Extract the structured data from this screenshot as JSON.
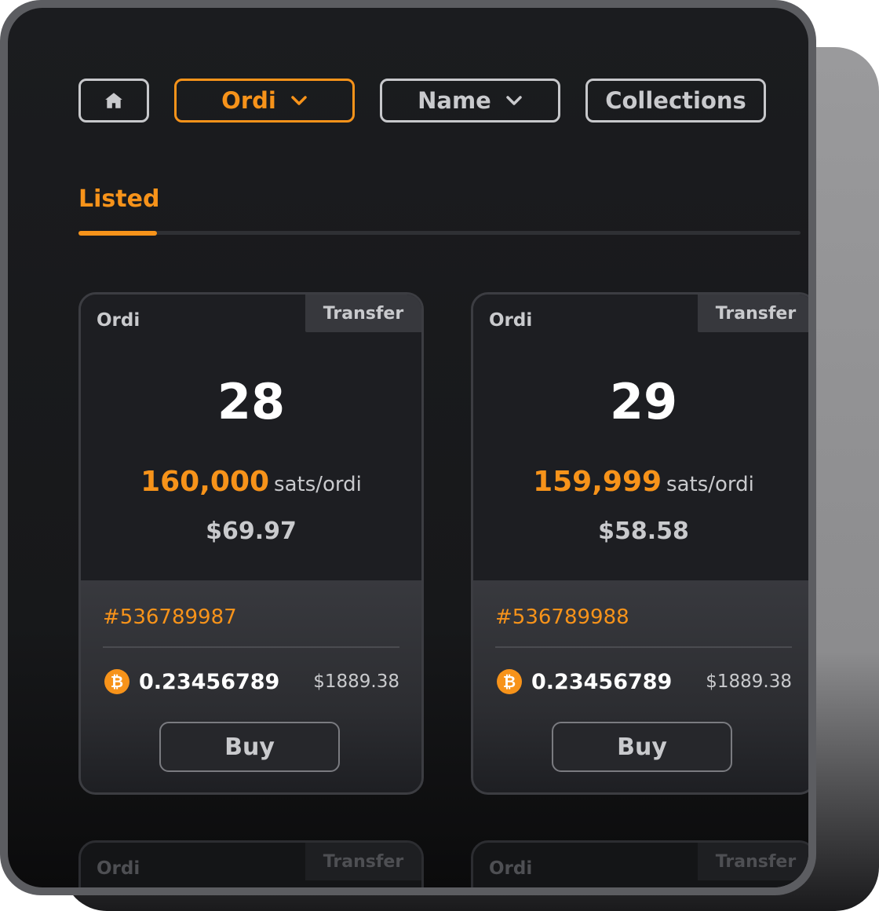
{
  "toolbar": {
    "home_icon": "home-icon",
    "collection_label": "Ordi",
    "sort_label": "Name",
    "collections_label": "Collections"
  },
  "tabs": {
    "active_label": "Listed"
  },
  "colors": {
    "accent": "#f7931a",
    "background": "#1b1c1f",
    "text_muted": "#c9cacd"
  },
  "cards": [
    {
      "ticker": "Ordi",
      "tag": "Transfer",
      "amount": "28",
      "price_value": "160,000",
      "price_unit": "sats/ordi",
      "usd_value": "$69.97",
      "inscription_id": "#536789987",
      "btc_symbol": "₿",
      "btc_amount": "0.23456789",
      "btc_usd": "$1889.38",
      "buy_label": "Buy"
    },
    {
      "ticker": "Ordi",
      "tag": "Transfer",
      "amount": "29",
      "price_value": "159,999",
      "price_unit": "sats/ordi",
      "usd_value": "$58.58",
      "inscription_id": "#536789988",
      "btc_symbol": "₿",
      "btc_amount": "0.23456789",
      "btc_usd": "$1889.38",
      "buy_label": "Buy"
    }
  ],
  "partial_cards": [
    {
      "ticker": "Ordi",
      "tag": "Transfer"
    },
    {
      "ticker": "Ordi",
      "tag": "Transfer"
    }
  ]
}
